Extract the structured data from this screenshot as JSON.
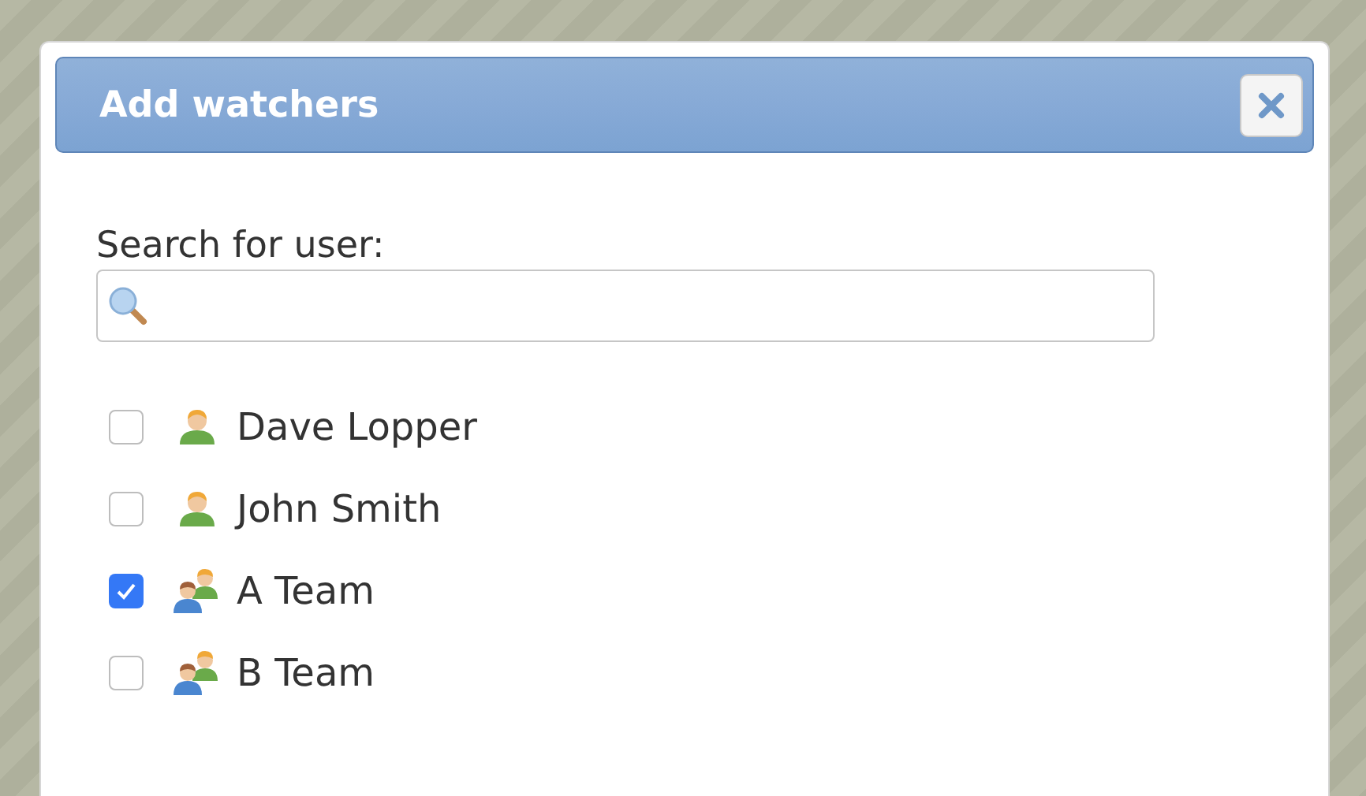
{
  "dialog": {
    "title": "Add watchers"
  },
  "search": {
    "label": "Search for user:"
  },
  "users": [
    {
      "name": "Dave Lopper",
      "kind": "user",
      "checked": false
    },
    {
      "name": "John Smith",
      "kind": "user",
      "checked": false
    },
    {
      "name": "A Team",
      "kind": "group",
      "checked": true
    },
    {
      "name": "B Team",
      "kind": "group",
      "checked": false
    }
  ]
}
